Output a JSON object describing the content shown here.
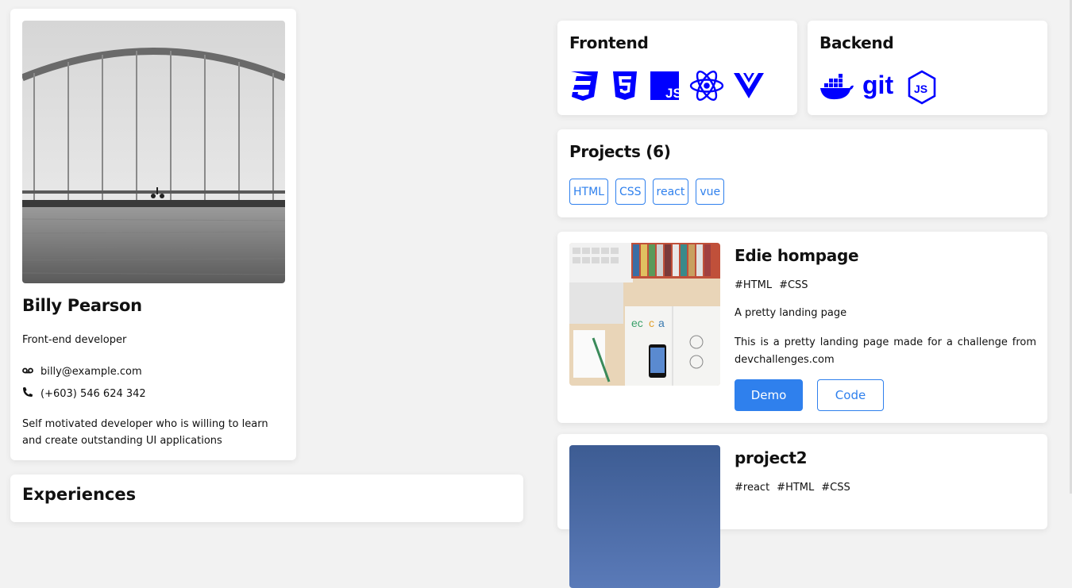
{
  "profile": {
    "name": "Billy Pearson",
    "role": "Front-end developer",
    "email": "billy@example.com",
    "phone": "(+603) 546 624 342",
    "bio": "Self motivated developer who is willing to learn and create outstanding UI applications"
  },
  "experience": {
    "title": "Experiences"
  },
  "skills": {
    "frontend": {
      "title": "Frontend",
      "icons": [
        "css3-icon",
        "html5-icon",
        "javascript-icon",
        "react-icon",
        "vue-icon"
      ]
    },
    "backend": {
      "title": "Backend",
      "icons": [
        "docker-icon",
        "git-icon",
        "nodejs-icon"
      ]
    }
  },
  "projects": {
    "title": "Projects (6)",
    "filters": [
      "HTML",
      "CSS",
      "react",
      "vue"
    ],
    "items": [
      {
        "title": "Edie hompage",
        "tags": [
          "#HTML",
          "#CSS"
        ],
        "description": "A pretty landing page",
        "text": "This is a pretty landing page made for a challenge from devchallenges.com",
        "demo_label": "Demo",
        "code_label": "Code"
      },
      {
        "title": "project2",
        "tags": [
          "#react",
          "#HTML",
          "#CSS"
        ]
      }
    ]
  },
  "colors": {
    "accent": "#2f80ed",
    "icon_blue": "#0000ff",
    "background": "#f2f2f2"
  }
}
